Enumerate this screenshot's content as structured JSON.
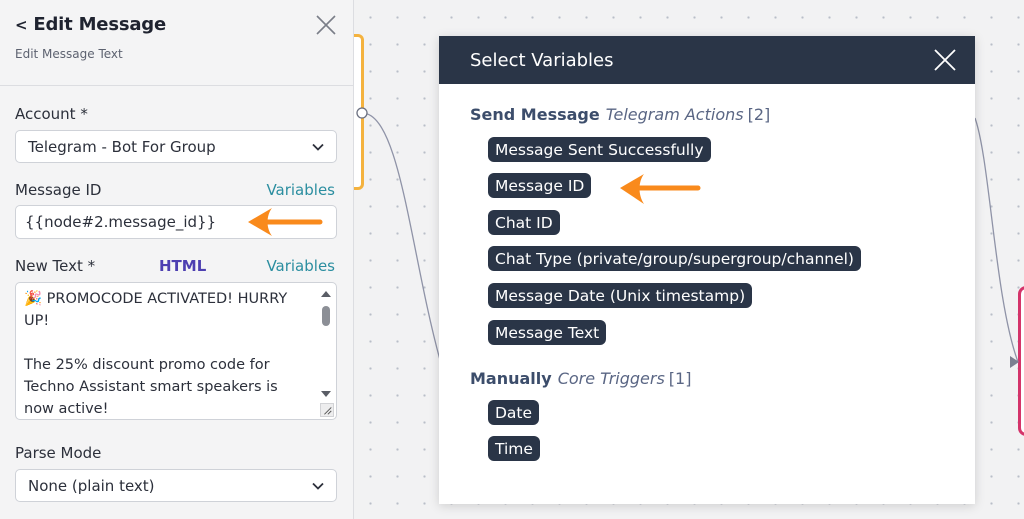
{
  "panel": {
    "title": "Edit Message",
    "subtitle": "Edit Message Text",
    "account_label": "Account *",
    "account_value": "Telegram - Bot For Group",
    "message_id_label": "Message ID",
    "variables_link": "Variables",
    "message_id_value": "{{node#2.message_id}}",
    "new_text_label": "New Text *",
    "html_link": "HTML",
    "new_text_value": "🎉 PROMOCODE ACTIVATED! HURRY UP!\n\nThe 25% discount promo code for Techno Assistant smart speakers is now active!",
    "parse_mode_label": "Parse Mode",
    "parse_mode_value": "None (plain text)"
  },
  "modal": {
    "title": "Select Variables",
    "groups": [
      {
        "name": "Send Message",
        "subtitle": "Telegram Actions",
        "count": "[2]",
        "items": [
          "Message Sent Successfully",
          "Message ID",
          "Chat ID",
          "Chat Type (private/group/supergroup/channel)",
          "Message Date (Unix timestamp)",
          "Message Text"
        ]
      },
      {
        "name": "Manually",
        "subtitle": "Core Triggers",
        "count": "[1]",
        "items": [
          "Date",
          "Time"
        ]
      }
    ]
  },
  "colors": {
    "accent_orange": "#f98a1c",
    "modal_header": "#2a3547",
    "variables_link": "#2b8ea0",
    "html_link": "#4d3fb1",
    "node_border_yellow": "#f4b23e",
    "node_border_pink": "#d4346a"
  },
  "icons": {
    "back": "chevron-left-icon",
    "close": "close-icon",
    "dropdown": "chevron-down-icon",
    "pointer": "orange-arrow-icon"
  }
}
